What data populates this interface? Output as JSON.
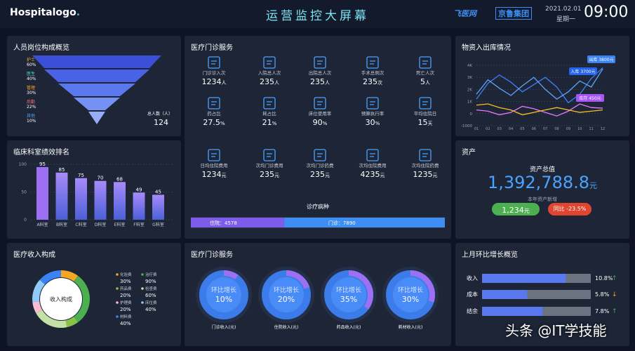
{
  "header": {
    "logo": "Hospitalogo",
    "logo_dot": ".",
    "title": "运营监控大屏幕",
    "brand1": "飞医网",
    "brand2": "京鲁集团",
    "date": "2021.02.01",
    "weekday": "星期一",
    "time": "09:00"
  },
  "staff": {
    "title": "人员岗位构成概览",
    "total_label": "总人数（人）",
    "total_value": "124",
    "items": [
      {
        "label": "护士",
        "pct": "60%"
      },
      {
        "label": "医生",
        "pct": "40%"
      },
      {
        "label": "管理",
        "pct": "30%"
      },
      {
        "label": "后勤",
        "pct": "22%"
      },
      {
        "label": "其他",
        "pct": "10%"
      }
    ]
  },
  "dept": {
    "title": "临床科室绩效排名",
    "yticks": [
      "100",
      "50",
      "0"
    ]
  },
  "income": {
    "title": "医疗收入构成",
    "center": "收入构成",
    "legend": [
      {
        "name": "化验费",
        "pct": "30%"
      },
      {
        "name": "治疗费",
        "pct": "90%"
      },
      {
        "name": "药品费",
        "pct": "20%"
      },
      {
        "name": "检查费",
        "pct": "60%"
      },
      {
        "name": "护理费",
        "pct": "20%"
      },
      {
        "name": "床位费",
        "pct": "40%"
      },
      {
        "name": "材料费",
        "pct": "40%"
      }
    ]
  },
  "service": {
    "title": "医疗门诊服务",
    "items": [
      {
        "icon": "outpatient-icon",
        "label": "门诊诊入次",
        "value": "1234",
        "unit": "人"
      },
      {
        "icon": "admission-icon",
        "label": "入院总人次",
        "value": "235",
        "unit": "人"
      },
      {
        "icon": "discharge-icon",
        "label": "出院总人次",
        "value": "235",
        "unit": "人"
      },
      {
        "icon": "surgery-icon",
        "label": "手术总例次",
        "value": "235",
        "unit": "次"
      },
      {
        "icon": "death-icon",
        "label": "死亡人次",
        "value": "5",
        "unit": "人"
      },
      {
        "icon": "drug-ratio-icon",
        "label": "药占比",
        "value": "27.5",
        "unit": "%"
      },
      {
        "icon": "consumable-icon",
        "label": "耗占比",
        "value": "21",
        "unit": "%"
      },
      {
        "icon": "bed-usage-icon",
        "label": "床位使用率",
        "value": "90",
        "unit": "%"
      },
      {
        "icon": "budget-icon",
        "label": "预算执行率",
        "value": "30",
        "unit": "%"
      },
      {
        "icon": "stay-days-icon",
        "label": "平均住院日",
        "value": "15",
        "unit": "天"
      },
      {
        "icon": "daily-cost-icon",
        "label": "日均住院费用",
        "value": "1234",
        "unit": "元"
      },
      {
        "icon": "outpatient-cost-icon",
        "label": "次均门诊费用",
        "value": "235",
        "unit": "元"
      },
      {
        "icon": "outpatient-drug-icon",
        "label": "次均门诊药费",
        "value": "235",
        "unit": "元"
      },
      {
        "icon": "inpatient-cost-icon",
        "label": "次均住院费用",
        "value": "4235",
        "unit": "元"
      },
      {
        "icon": "inpatient-drug-icon",
        "label": "次均住院药费",
        "value": "1235",
        "unit": "元"
      }
    ],
    "diag_title": "诊疗病种",
    "inpatient_label": "住院：4578",
    "outpatient_label": "门诊：7890"
  },
  "service2": {
    "title": "医疗门诊服务",
    "ring_label": "环比增长",
    "rings": [
      {
        "pct": "10%",
        "label": "门诊收入(元)"
      },
      {
        "pct": "20%",
        "label": "住院收入(元)"
      },
      {
        "pct": "35%",
        "label": "药品收入(元)"
      },
      {
        "pct": "30%",
        "label": "耗材收入(元)"
      }
    ]
  },
  "supplies": {
    "title": "物资入出库情况",
    "tags": [
      {
        "text": "出库 3800元"
      },
      {
        "text": "入库 3700元"
      },
      {
        "text": "库存 450元"
      }
    ]
  },
  "assets": {
    "title": "资产",
    "total_label": "资产总值",
    "total_value": "1,392,788.8",
    "total_unit": "元",
    "new_label": "本年资产新增",
    "new_value": "1,234",
    "new_unit": "元",
    "yoy": "同比 -23.5%"
  },
  "growth": {
    "title": "上月环比增长概览",
    "rows": [
      {
        "label": "收入",
        "value": "10.8%",
        "arrow": "↑"
      },
      {
        "label": "成本",
        "value": "5.8%",
        "arrow": "↓"
      },
      {
        "label": "结余",
        "value": "7.8%",
        "arrow": "↑"
      }
    ]
  },
  "watermark": "头条 @IT学技能",
  "chart_data": [
    {
      "type": "bar",
      "title": "临床科室绩效排名",
      "categories": [
        "A科室",
        "B科室",
        "C科室",
        "D科室",
        "E科室",
        "F科室",
        "G科室"
      ],
      "values": [
        95,
        85,
        75,
        70,
        68,
        49,
        45
      ],
      "ylim": [
        0,
        100
      ]
    },
    {
      "type": "funnel",
      "title": "人员岗位构成概览",
      "categories": [
        "护士",
        "医生",
        "管理",
        "后勤",
        "其他"
      ],
      "values": [
        60,
        40,
        30,
        22,
        10
      ]
    },
    {
      "type": "pie",
      "title": "医疗收入构成",
      "categories": [
        "化验费",
        "治疗费",
        "药品费",
        "检查费",
        "护理费",
        "床位费",
        "材料费"
      ],
      "values": [
        30,
        90,
        20,
        60,
        20,
        40,
        40
      ]
    },
    {
      "type": "line",
      "title": "物资入出库情况",
      "x": [
        "01",
        "02",
        "03",
        "04",
        "05",
        "06",
        "07",
        "08",
        "09",
        "10",
        "11",
        "12"
      ],
      "ylim": [
        -1000,
        4000
      ],
      "yticks": [
        "4K",
        "3K",
        "2K",
        "1K",
        "0",
        "-1000"
      ],
      "series": [
        {
          "name": "出库",
          "color": "#3b82f6",
          "values": [
            1200,
            2500,
            3200,
            2600,
            1800,
            2400,
            3000,
            2200,
            900,
            1600,
            2900,
            3800
          ]
        },
        {
          "name": "入库",
          "color": "#60a5fa",
          "values": [
            1600,
            2800,
            2100,
            1500,
            2300,
            3000,
            2000,
            1200,
            1800,
            2700,
            2200,
            3700
          ]
        },
        {
          "name": "库存",
          "color": "#e879f9",
          "values": [
            300,
            200,
            -100,
            100,
            600,
            400,
            100,
            -200,
            200,
            800,
            500,
            450
          ]
        },
        {
          "color": "#fbbf24",
          "values": [
            700,
            800,
            500,
            300,
            -100,
            100,
            300,
            500,
            300,
            100,
            200,
            300
          ]
        }
      ]
    },
    {
      "type": "bar",
      "title": "诊疗病种",
      "categories": [
        "住院",
        "门诊"
      ],
      "values": [
        4578,
        7890
      ]
    },
    {
      "type": "bar",
      "title": "上月环比增长概览",
      "categories": [
        "收入",
        "成本",
        "结余"
      ],
      "values": [
        10.8,
        5.8,
        7.8
      ]
    },
    {
      "type": "pie",
      "title": "医疗门诊服务",
      "categories": [
        "门诊收入(元)",
        "住院收入(元)",
        "药品收入(元)",
        "耗材收入(元)"
      ],
      "values": [
        10,
        20,
        35,
        30
      ]
    }
  ]
}
